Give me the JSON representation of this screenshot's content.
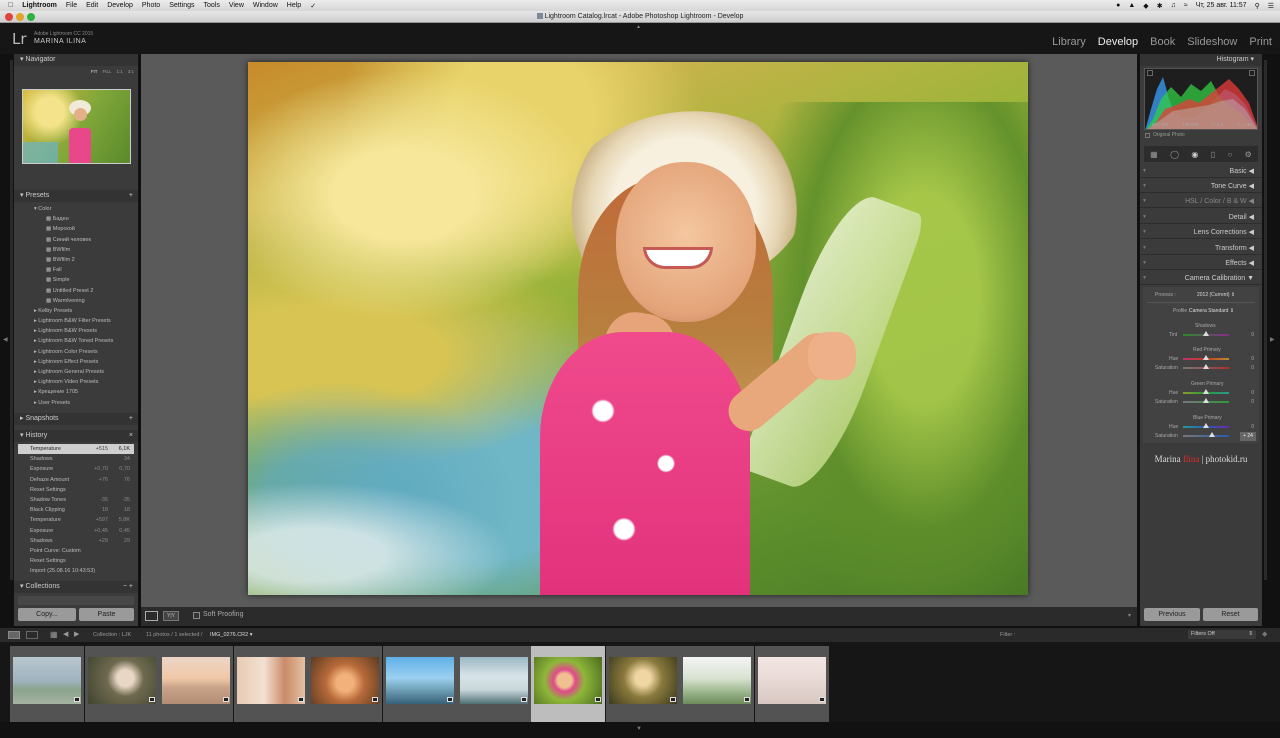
{
  "menubar": {
    "app": "Lightroom",
    "items": [
      "File",
      "Edit",
      "Develop",
      "Photo",
      "Settings",
      "Tools",
      "View",
      "Window",
      "Help"
    ],
    "clock": "Чт, 25 авг.  11:57"
  },
  "window_title": "Lightroom Catalog.lrcat - Adobe Photoshop Lightroom - Develop",
  "identity": {
    "product": "Adobe Lightroom CC 2015",
    "user": "MARINA ILINA",
    "logo": "Lr"
  },
  "modules": [
    "Library",
    "Develop",
    "Book",
    "Slideshow",
    "Print"
  ],
  "left": {
    "navigator": {
      "title": "Navigator",
      "zoom": [
        "FIT",
        "FILL",
        "1:1",
        "3:1"
      ]
    },
    "presets": {
      "title": "Presets",
      "items": [
        "Color",
        "Баден",
        "Морской",
        "Синий человек",
        "BWfilm",
        "BWfilm 2",
        "Fall",
        "Simple",
        "Untitled Preset 2",
        "Warmlvening",
        "Kelby Presets",
        "Lightroom B&W Filter Presets",
        "Lightroom B&W Presets",
        "Lightroom B&W Toned Presets",
        "Lightroom Color Presets",
        "Lightroom Effect Presets",
        "Lightroom General Presets",
        "Lightroom Video Presets",
        "Крещение 1705",
        "User Presets"
      ]
    },
    "snapshots": {
      "title": "Snapshots"
    },
    "history": {
      "title": "History",
      "items": [
        {
          "name": "Temperature",
          "a": "+515",
          "b": "6,1K"
        },
        {
          "name": "Shadows",
          "a": "",
          "b": "34"
        },
        {
          "name": "Exposure",
          "a": "+0,70",
          "b": "0,70"
        },
        {
          "name": "Dehaze Amount",
          "a": "+76",
          "b": "76"
        },
        {
          "name": "Reset Settings",
          "a": "",
          "b": ""
        },
        {
          "name": "Shadow Tones",
          "a": "-35",
          "b": "-35"
        },
        {
          "name": "Black Clipping",
          "a": "18",
          "b": "18"
        },
        {
          "name": "Temperature",
          "a": "+597",
          "b": "5,8K"
        },
        {
          "name": "Exposure",
          "a": "+0,45",
          "b": "0,45"
        },
        {
          "name": "Shadows",
          "a": "+29",
          "b": "29"
        },
        {
          "name": "Point Curve: Custom",
          "a": "",
          "b": ""
        },
        {
          "name": "Reset Settings",
          "a": "",
          "b": ""
        },
        {
          "name": "Import (25.08.16 10:43:53)",
          "a": "",
          "b": ""
        }
      ]
    },
    "collections": {
      "title": "Collections"
    },
    "copy_label": "Copy...",
    "paste_label": "Paste"
  },
  "toolbar": {
    "soft_proofing": "Soft Proofing"
  },
  "right": {
    "histogram": {
      "title": "Histogram",
      "iso": "ISO 100",
      "focal": "135 mm",
      "aperture": "f / 2,0",
      "shutter": "¹⁄₁₆₀ сек",
      "original": "Original Photo"
    },
    "panels": [
      "Basic",
      "Tone Curve",
      "HSL  /  Color  /  B & W",
      "Detail",
      "Lens Corrections",
      "Transform",
      "Effects",
      "Camera Calibration"
    ],
    "calibration": {
      "process_label": "Process :",
      "process_value": "2012 (Current)",
      "profile_label": "Profile :",
      "profile_value": "Camera Standard",
      "shadows": "Shadows",
      "tint": "Tint",
      "red": "Red Primary",
      "green": "Green Primary",
      "blue": "Blue Primary",
      "hue": "Hue",
      "saturation": "Saturation",
      "values": {
        "tint": "0",
        "red_hue": "0",
        "red_sat": "0",
        "green_hue": "0",
        "green_sat": "0",
        "blue_hue": "0",
        "blue_sat": "+ 24"
      }
    },
    "watermark": {
      "first": "Marina ",
      "middle": "Ilina",
      "rest": " | photokid.ru"
    },
    "previous_label": "Previous",
    "reset_label": "Reset"
  },
  "filmbar": {
    "collection": "Collection : LJK",
    "count": "11 photos / 1 selected /",
    "file": "IMG_0276.CR2",
    "filter_label": "Filter :",
    "filter_value": "Filters Off"
  },
  "thumbnails": [
    {
      "bg": "linear-gradient(#b9c6cf 0%,#9fb3bf 50%,#8aa48c 70%,#a6b2a3 100%)"
    },
    {
      "bg": "radial-gradient(circle at 55% 45%,#e9d7c5 0 18%,#6f6a4f 40%,#3f4430 100%)"
    },
    {
      "bg": "linear-gradient(#ecd5c6 0%,#f1c8a8 45%,#c9a48a 65%,#b38d73 100%)"
    },
    {
      "bg": "linear-gradient(90deg,#e8cbb4,#f3e1d0 40%,#c98b6a 70%,#e4c0a2)"
    },
    {
      "bg": "radial-gradient(circle at 50% 55%,#f2b17a 0 20%,#b86a3a 45%,#5a3a22 100%)"
    },
    {
      "bg": "linear-gradient(#5fb0e8 0%,#9cd0f0 45%,#6e9fb5 70%,#38617a 100%)"
    },
    {
      "bg": "linear-gradient(#9cb8c4 0%,#d6e3e8 40%,#c9d6da 70%,#4f6f73 100%)"
    },
    {
      "bg": "radial-gradient(circle at 45% 50%,#f0c090 0 16%,#e04a8a 25%,#8fb73a 45%,#4a6a1f 100%)"
    },
    {
      "bg": "radial-gradient(circle at 50% 45%,#f0d6a2 0 18%,#8a7a3d 45%,#3c3a1c 100%)"
    },
    {
      "bg": "linear-gradient(#f4f4f4 0%,#d9e2d2 45%,#9ab58c 75%,#6c8a5a 100%)"
    },
    {
      "bg": "linear-gradient(#f2e6e2 0%,#eadbd8 45%,#d8c7c1 100%)"
    }
  ]
}
